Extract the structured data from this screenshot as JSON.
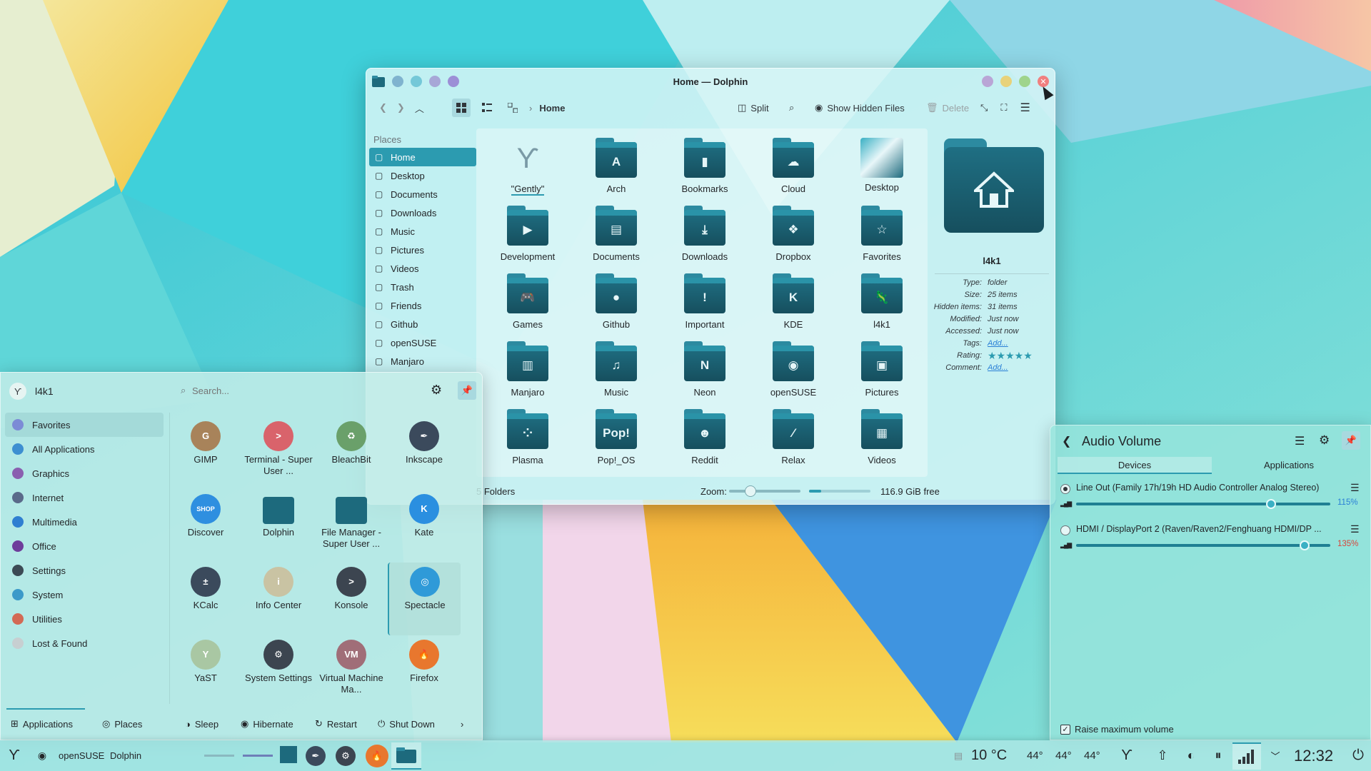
{
  "dolphin": {
    "title": "Home — Dolphin",
    "breadcrumb": "Home",
    "toolbar": {
      "split": "Split",
      "show_hidden": "Show Hidden Files",
      "delete": "Delete"
    },
    "places_header": "Places",
    "places": [
      {
        "label": "Home",
        "icon": "home-icon",
        "selected": true
      },
      {
        "label": "Desktop",
        "icon": "desktop-icon"
      },
      {
        "label": "Documents",
        "icon": "documents-icon"
      },
      {
        "label": "Downloads",
        "icon": "downloads-icon"
      },
      {
        "label": "Music",
        "icon": "music-icon"
      },
      {
        "label": "Pictures",
        "icon": "pictures-icon"
      },
      {
        "label": "Videos",
        "icon": "videos-icon"
      },
      {
        "label": "Trash",
        "icon": "trash-icon"
      },
      {
        "label": "Friends",
        "icon": "friends-icon"
      },
      {
        "label": "Github",
        "icon": "github-icon"
      },
      {
        "label": "openSUSE",
        "icon": "opensuse-icon"
      },
      {
        "label": "Manjaro",
        "icon": "manjaro-icon"
      }
    ],
    "files": [
      {
        "name": "\"Gently\"",
        "sym": "ϒ",
        "kind": "logo"
      },
      {
        "name": "Arch",
        "sym": "A"
      },
      {
        "name": "Bookmarks",
        "sym": "▮"
      },
      {
        "name": "Cloud",
        "sym": "☁"
      },
      {
        "name": "Desktop",
        "sym": "",
        "kind": "desktop"
      },
      {
        "name": "Development",
        "sym": "▶"
      },
      {
        "name": "Documents",
        "sym": "▤"
      },
      {
        "name": "Downloads",
        "sym": "⤓"
      },
      {
        "name": "Dropbox",
        "sym": "❖"
      },
      {
        "name": "Favorites",
        "sym": "☆"
      },
      {
        "name": "Games",
        "sym": "🎮"
      },
      {
        "name": "Github",
        "sym": "●"
      },
      {
        "name": "Important",
        "sym": "!"
      },
      {
        "name": "KDE",
        "sym": "K"
      },
      {
        "name": "l4k1",
        "sym": "🦎"
      },
      {
        "name": "Manjaro",
        "sym": "▥"
      },
      {
        "name": "Music",
        "sym": "♫"
      },
      {
        "name": "Neon",
        "sym": "N"
      },
      {
        "name": "openSUSE",
        "sym": "◉"
      },
      {
        "name": "Pictures",
        "sym": "▣"
      },
      {
        "name": "Plasma",
        "sym": "⁘"
      },
      {
        "name": "Pop!_OS",
        "sym": "Pop!"
      },
      {
        "name": "Reddit",
        "sym": "☻"
      },
      {
        "name": "Relax",
        "sym": "⁄"
      },
      {
        "name": "Videos",
        "sym": "▦"
      }
    ],
    "info": {
      "name": "l4k1",
      "rows": [
        {
          "k": "Type:",
          "v": "folder"
        },
        {
          "k": "Size:",
          "v": "25 items"
        },
        {
          "k": "Hidden items:",
          "v": "31 items"
        },
        {
          "k": "Modified:",
          "v": "Just now"
        },
        {
          "k": "Accessed:",
          "v": "Just now"
        },
        {
          "k": "Tags:",
          "v": "Add...",
          "link": true
        },
        {
          "k": "Rating:",
          "v": "★★★★★",
          "rating": true
        },
        {
          "k": "Comment:",
          "v": "Add...",
          "link": true
        }
      ]
    },
    "status": {
      "count": "5 Folders",
      "zoom_label": "Zoom:",
      "zoom_level": 0.3,
      "free_fill": 0.2,
      "free": "116.9 GiB free"
    }
  },
  "launcher": {
    "user": "l4k1",
    "search_placeholder": "Search...",
    "categories": [
      {
        "label": "Favorites",
        "color": "#7c8bd6",
        "selected": true
      },
      {
        "label": "All Applications",
        "color": "#3d8fd1"
      },
      {
        "label": "Graphics",
        "color": "#8a5fb0"
      },
      {
        "label": "Internet",
        "color": "#5a6a8a"
      },
      {
        "label": "Multimedia",
        "color": "#2f7fd1"
      },
      {
        "label": "Office",
        "color": "#6e3d9b"
      },
      {
        "label": "Settings",
        "color": "#3c4a55"
      },
      {
        "label": "System",
        "color": "#3c9ac9"
      },
      {
        "label": "Utilities",
        "color": "#d36a55"
      },
      {
        "label": "Lost & Found",
        "color": "#c7cfd1"
      }
    ],
    "apps": [
      {
        "label": "GIMP",
        "color": "#a8835a",
        "glyph": "G"
      },
      {
        "label": "Terminal - Super User ...",
        "color": "#d9636b",
        "glyph": ">"
      },
      {
        "label": "BleachBit",
        "color": "#6aa06a",
        "glyph": "♻"
      },
      {
        "label": "Inkscape",
        "color": "#3b4a5c",
        "glyph": "✒"
      },
      {
        "label": "Discover",
        "color": "#2e8fe0",
        "glyph": "SHOP"
      },
      {
        "label": "Dolphin",
        "color": "#1d6a7d",
        "glyph": ""
      },
      {
        "label": "File Manager - Super User ...",
        "color": "#1d6a7d",
        "glyph": ""
      },
      {
        "label": "Kate",
        "color": "#2a8fe0",
        "glyph": "K"
      },
      {
        "label": "KCalc",
        "color": "#3b4a5c",
        "glyph": "±"
      },
      {
        "label": "Info Center",
        "color": "#c9c3a3",
        "glyph": "i"
      },
      {
        "label": "Konsole",
        "color": "#3c4550",
        "glyph": ">"
      },
      {
        "label": "Spectacle",
        "color": "#2f9ad8",
        "glyph": "◎",
        "selected": true
      },
      {
        "label": "YaST",
        "color": "#a9c7a3",
        "glyph": "Y"
      },
      {
        "label": "System Settings",
        "color": "#3c4550",
        "glyph": "⚙"
      },
      {
        "label": "Virtual Machine Ma...",
        "color": "#a06e78",
        "glyph": "VM"
      },
      {
        "label": "Firefox",
        "color": "#e8772e",
        "glyph": "🔥"
      }
    ],
    "footer": {
      "applications": "Applications",
      "places": "Places",
      "sleep": "Sleep",
      "hibernate": "Hibernate",
      "restart": "Restart",
      "shutdown": "Shut Down"
    }
  },
  "audio": {
    "title": "Audio Volume",
    "tabs": [
      "Devices",
      "Applications"
    ],
    "devices": [
      {
        "name": "Line Out (Family 17h/19h HD Audio Controller Analog Stereo)",
        "percent": "115%",
        "level": 1.15,
        "selected": true,
        "pct_color": "#2a7fd6"
      },
      {
        "name": "HDMI / DisplayPort 2 (Raven/Raven2/Fenghuang HDMI/DP ...",
        "percent": "135%",
        "level": 1.35,
        "selected": false,
        "pct_color": "#d9453b"
      }
    ],
    "raise_max": "Raise maximum volume"
  },
  "panel": {
    "activity": "openSUSE",
    "window": "Dolphin",
    "temp": "10 °C",
    "t1": "44°",
    "t2": "44°",
    "t3": "44°",
    "clock": "12:32"
  }
}
